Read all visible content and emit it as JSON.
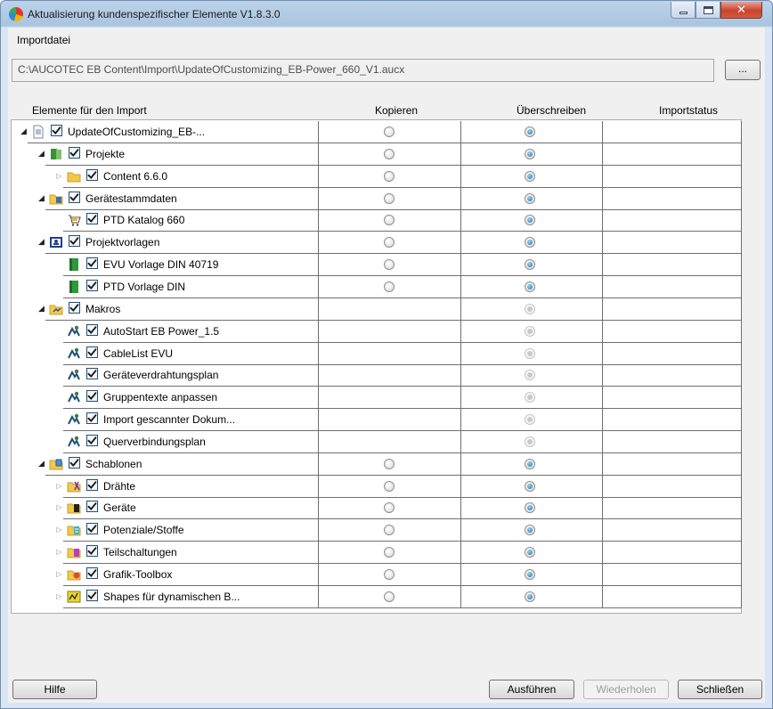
{
  "window": {
    "title": "Aktualisierung kundenspezifischer Elemente V1.8.3.0"
  },
  "import": {
    "label": "Importdatei",
    "path": "C:\\AUCOTEC EB Content\\Import\\UpdateOfCustomizing_EB-Power_660_V1.aucx",
    "browse_label": "..."
  },
  "columns": {
    "elements": "Elemente für den Import",
    "copy": "Kopieren",
    "overwrite": "Überschreiben",
    "status": "Importstatus"
  },
  "tree": [
    {
      "label": "UpdateOfCustomizing_EB-...",
      "level": 0,
      "toggle": "open",
      "icon": "document-icon",
      "checked": true,
      "copy": "off",
      "overwrite": "on"
    },
    {
      "label": "Projekte",
      "level": 1,
      "toggle": "open",
      "icon": "projects-icon",
      "checked": true,
      "copy": "off",
      "overwrite": "on"
    },
    {
      "label": "Content 6.6.0",
      "level": 2,
      "toggle": "closed",
      "icon": "folder-icon",
      "checked": true,
      "copy": "off",
      "overwrite": "on"
    },
    {
      "label": "Gerätestammdaten",
      "level": 1,
      "toggle": "open",
      "icon": "device-master-data-icon",
      "checked": true,
      "copy": "off",
      "overwrite": "on"
    },
    {
      "label": "PTD Katalog 660",
      "level": 2,
      "toggle": "none",
      "icon": "catalog-cart-icon",
      "checked": true,
      "copy": "off",
      "overwrite": "on"
    },
    {
      "label": "Projektvorlagen",
      "level": 1,
      "toggle": "open",
      "icon": "project-templates-icon",
      "checked": true,
      "copy": "off",
      "overwrite": "on"
    },
    {
      "label": "EVU Vorlage DIN 40719",
      "level": 2,
      "toggle": "none",
      "icon": "template-book-icon",
      "checked": true,
      "copy": "off",
      "overwrite": "on"
    },
    {
      "label": "PTD Vorlage DIN",
      "level": 2,
      "toggle": "none",
      "icon": "template-book-icon",
      "checked": true,
      "copy": "off",
      "overwrite": "on"
    },
    {
      "label": "Makros",
      "level": 1,
      "toggle": "open",
      "icon": "macros-icon",
      "checked": true,
      "copy": "none",
      "overwrite": "disabled"
    },
    {
      "label": "AutoStart EB Power_1.5",
      "level": 2,
      "toggle": "none",
      "icon": "macro-icon",
      "checked": true,
      "copy": "none",
      "overwrite": "disabled"
    },
    {
      "label": "CableList EVU",
      "level": 2,
      "toggle": "none",
      "icon": "macro-icon",
      "checked": true,
      "copy": "none",
      "overwrite": "disabled"
    },
    {
      "label": "Geräteverdrahtungsplan",
      "level": 2,
      "toggle": "none",
      "icon": "macro-icon",
      "checked": true,
      "copy": "none",
      "overwrite": "disabled"
    },
    {
      "label": "Gruppentexte anpassen",
      "level": 2,
      "toggle": "none",
      "icon": "macro-icon",
      "checked": true,
      "copy": "none",
      "overwrite": "disabled"
    },
    {
      "label": "Import gescannter Dokum...",
      "level": 2,
      "toggle": "none",
      "icon": "macro-icon",
      "checked": true,
      "copy": "none",
      "overwrite": "disabled"
    },
    {
      "label": "Querverbindungsplan",
      "level": 2,
      "toggle": "none",
      "icon": "macro-icon",
      "checked": true,
      "copy": "none",
      "overwrite": "disabled"
    },
    {
      "label": "Schablonen",
      "level": 1,
      "toggle": "open",
      "icon": "stencils-icon",
      "checked": true,
      "copy": "off",
      "overwrite": "on"
    },
    {
      "label": "Drähte",
      "level": 2,
      "toggle": "closed",
      "icon": "wires-icon",
      "checked": true,
      "copy": "off",
      "overwrite": "on"
    },
    {
      "label": "Geräte",
      "level": 2,
      "toggle": "closed",
      "icon": "devices-icon",
      "checked": true,
      "copy": "off",
      "overwrite": "on"
    },
    {
      "label": "Potenziale/Stoffe",
      "level": 2,
      "toggle": "closed",
      "icon": "potentials-icon",
      "checked": true,
      "copy": "off",
      "overwrite": "on"
    },
    {
      "label": "Teilschaltungen",
      "level": 2,
      "toggle": "closed",
      "icon": "subcircuits-icon",
      "checked": true,
      "copy": "off",
      "overwrite": "on"
    },
    {
      "label": "Grafik-Toolbox",
      "level": 2,
      "toggle": "closed",
      "icon": "graphics-toolbox-icon",
      "checked": true,
      "copy": "off",
      "overwrite": "on"
    },
    {
      "label": "Shapes für dynamischen B...",
      "level": 2,
      "toggle": "closed",
      "icon": "shapes-icon",
      "checked": true,
      "copy": "off",
      "overwrite": "on"
    }
  ],
  "buttons": {
    "help": "Hilfe",
    "run": "Ausführen",
    "redo": "Wiederholen",
    "close": "Schließen"
  },
  "colors": {
    "accent": "#1c6ea8",
    "titlebar": "#bcd3ea",
    "border": "#6f6f6f"
  }
}
